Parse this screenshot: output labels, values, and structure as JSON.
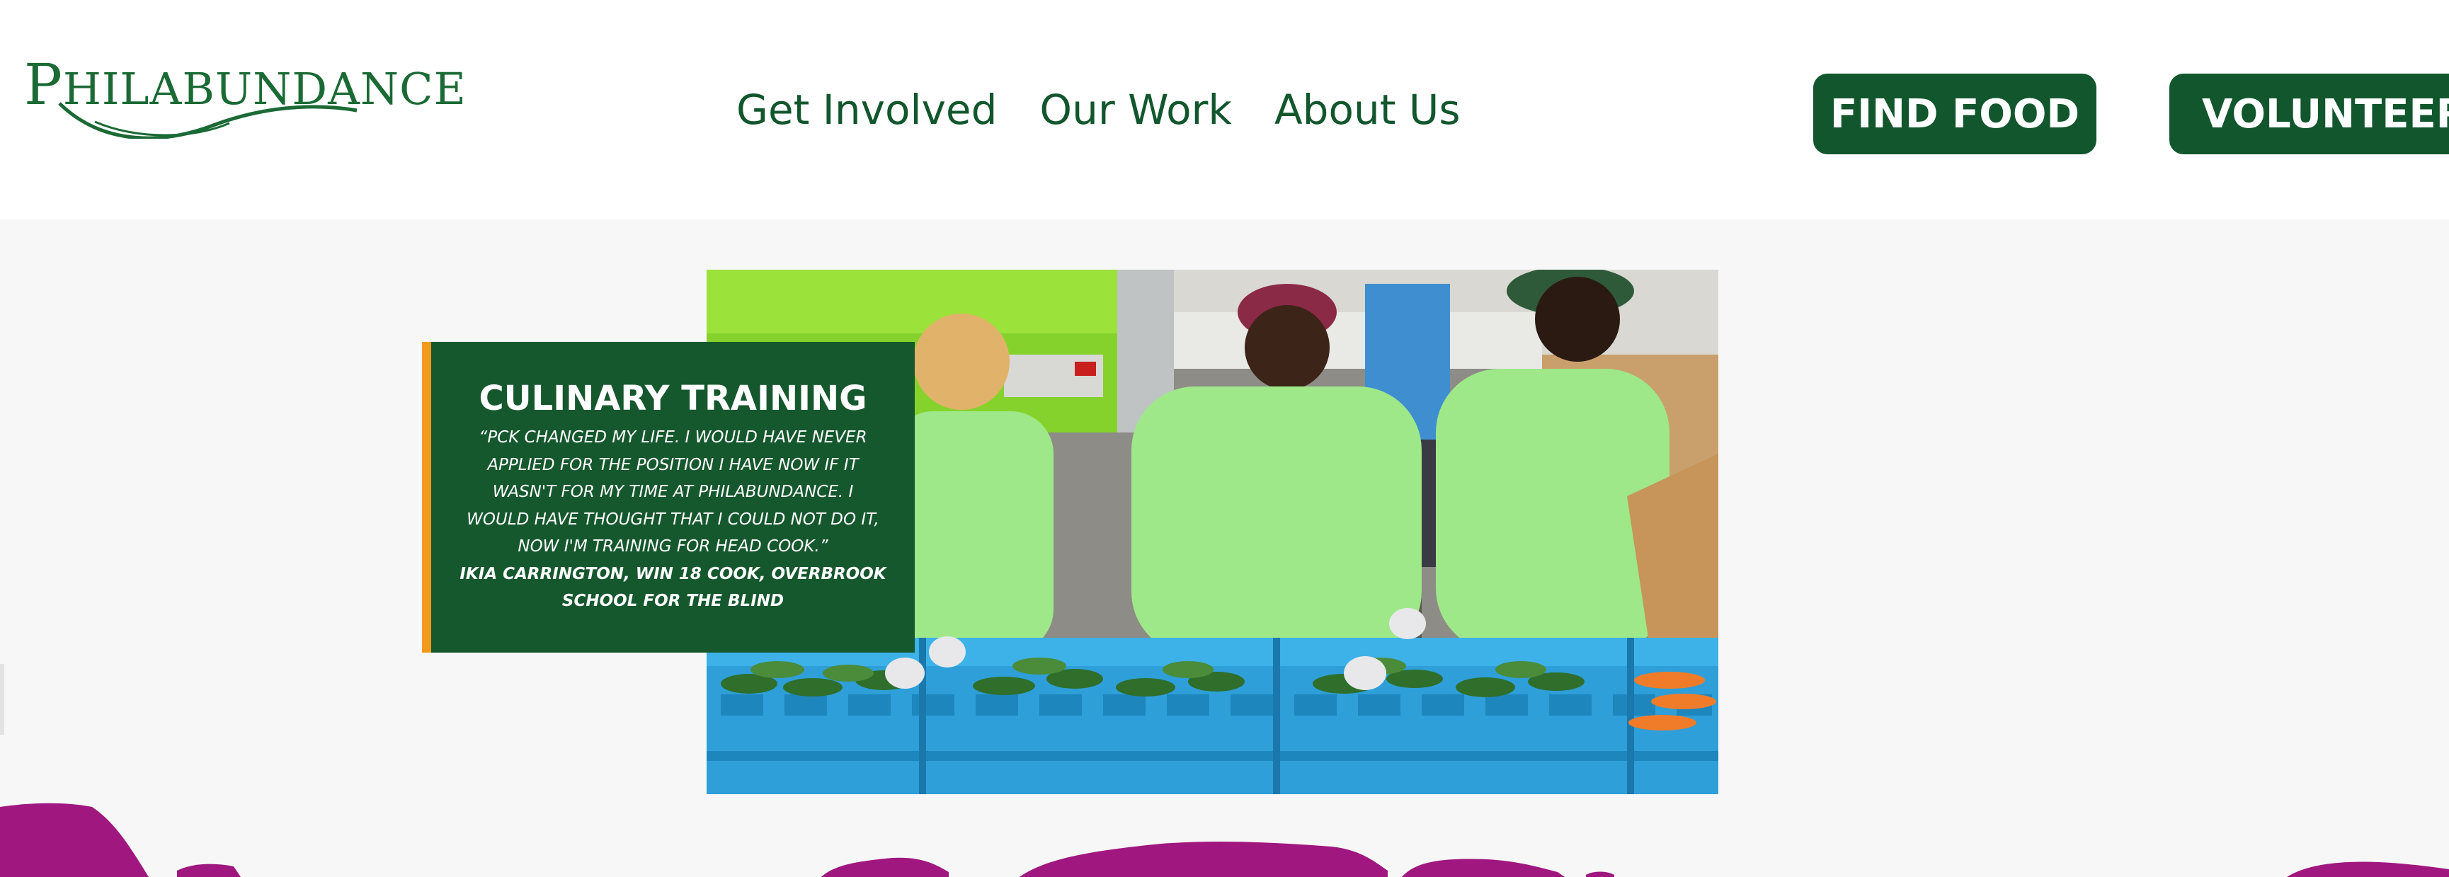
{
  "header": {
    "logo_text": "PHILABUNDANCE",
    "nav": [
      "Get Involved",
      "Our Work",
      "About Us"
    ],
    "find_food_label": "FIND FOOD",
    "volunteer_label": "VOLUNTEER"
  },
  "feature": {
    "title": "CULINARY TRAINING",
    "quote_lines": [
      "“PCK CHANGED MY LIFE. I WOULD HAVE NEVER",
      "APPLIED FOR THE POSITION I HAVE NOW IF IT",
      "WASN'T FOR MY TIME AT PHILABUNDANCE. I",
      "WOULD HAVE THOUGHT THAT I COULD NOT DO IT,",
      "NOW I'M TRAINING FOR HEAD COOK.”"
    ],
    "attribution_lines": [
      "IKIA CARRINGTON, WIN 18 COOK, OVERBROOK",
      "SCHOOL FOR THE BLIND"
    ]
  },
  "colors": {
    "brand_green": "#12562d",
    "card_green": "#16582e",
    "accent_orange": "#f39a1c",
    "brush_magenta": "#a0177f",
    "background": "#f7f7f7"
  }
}
